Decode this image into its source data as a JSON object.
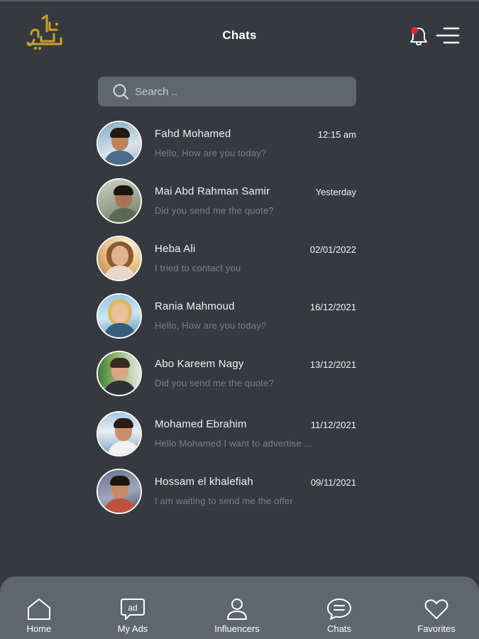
{
  "header": {
    "title": "Chats",
    "icons": {
      "logo": "brand-logo",
      "notification": "bell-icon",
      "menu": "menu-icon"
    },
    "notification_dot_color": "#e0252b"
  },
  "search": {
    "placeholder": "Search ..",
    "value": ""
  },
  "chats": [
    {
      "name": "Fahd Mohamed",
      "time": "12:15 am",
      "preview": "Hello, How are you today?"
    },
    {
      "name": "Mai Abd Rahman Samir",
      "time": "Yesterday",
      "preview": "Did you send me the quote?"
    },
    {
      "name": "Heba Ali",
      "time": "02/01/2022",
      "preview": "I tried to contact you"
    },
    {
      "name": "Rania  Mahmoud",
      "time": "16/12/2021",
      "preview": "Hello, How are you today?"
    },
    {
      "name": "Abo Kareem Nagy",
      "time": "13/12/2021",
      "preview": "Did you send me the quote?"
    },
    {
      "name": "Mohamed Ebrahim",
      "time": "11/12/2021",
      "preview": "Hello Mohamed I want to advertise ..."
    },
    {
      "name": "Hossam el khalefiah",
      "time": "09/11/2021",
      "preview": "I am waiting to send me the offer"
    }
  ],
  "nav": [
    {
      "label": "Home",
      "icon": "home-icon"
    },
    {
      "label": "My Ads",
      "icon": "ads-icon"
    },
    {
      "label": "Influencers",
      "icon": "user-icon"
    },
    {
      "label": "Chats",
      "icon": "chat-icon"
    },
    {
      "label": "Favorites",
      "icon": "heart-icon"
    }
  ],
  "colors": {
    "background": "#363a40",
    "surface": "#5f6670",
    "logo_gold": "#c9a227",
    "preview_text": "#7a818a"
  }
}
